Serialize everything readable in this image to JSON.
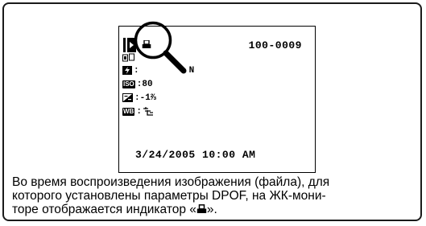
{
  "screen": {
    "frame_number": "100-0009",
    "iso_label": "ISO",
    "iso_value": ":80",
    "exposure_value": ":-1⅔",
    "wb_label": "WB",
    "wb_value": ":",
    "quality_value": "N",
    "datetime": "3/24/2005  10:00 AM"
  },
  "caption": {
    "line1": "Во время воспроизведения изображения (файла), для",
    "line2": "которого установлены параметры DPOF, на ЖК-мони-",
    "line3_before": "торе отображается индикатор «",
    "line3_after": "»."
  },
  "icons": {
    "playback": "playback-icon",
    "dpof": "printer-icon",
    "magnifier": "magnifier-icon",
    "flash": "flash-icon",
    "iso": "iso-icon",
    "exposure": "exposure-compensation-icon",
    "white_balance": "white-balance-icon",
    "wb_mode": "fluorescent-icon"
  }
}
